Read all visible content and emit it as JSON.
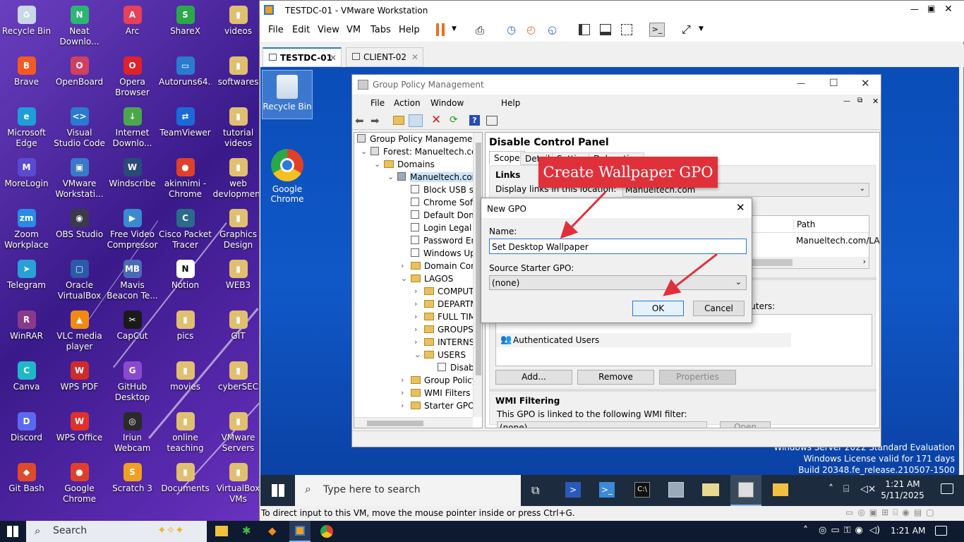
{
  "host_desktop": {
    "icons": [
      {
        "label": "Recycle Bin",
        "glyph": "♻",
        "color": "#c8d8e8"
      },
      {
        "label": "Neat Downlo...",
        "glyph": "N",
        "color": "#2bb673"
      },
      {
        "label": "Arc",
        "glyph": "A",
        "color": "#e8405a"
      },
      {
        "label": "ShareX",
        "glyph": "S",
        "color": "#2aa84a"
      },
      {
        "label": "videos",
        "glyph": "▮",
        "color": "#e0c070"
      },
      {
        "label": "Brave",
        "glyph": "B",
        "color": "#f25a23"
      },
      {
        "label": "OpenBoard",
        "glyph": "O",
        "color": "#d04060"
      },
      {
        "label": "Opera Browser",
        "glyph": "O",
        "color": "#e0202a"
      },
      {
        "label": "Autoruns64....",
        "glyph": "▭",
        "color": "#2a7ad0"
      },
      {
        "label": "softwares",
        "glyph": "▮",
        "color": "#e0c070"
      },
      {
        "label": "Microsoft Edge",
        "glyph": "e",
        "color": "#1e9ed8"
      },
      {
        "label": "Visual Studio Code",
        "glyph": "<>",
        "color": "#2a7ad0"
      },
      {
        "label": "Internet Downlo...",
        "glyph": "↓",
        "color": "#4aa84a"
      },
      {
        "label": "TeamViewer",
        "glyph": "⇄",
        "color": "#1a6ad8"
      },
      {
        "label": "tutorial videos",
        "glyph": "▮",
        "color": "#e0c070"
      },
      {
        "label": "MoreLogin",
        "glyph": "M",
        "color": "#5a4ad0"
      },
      {
        "label": "VMware Workstati...",
        "glyph": "▣",
        "color": "#3a78c8"
      },
      {
        "label": "Windscribe",
        "glyph": "W",
        "color": "#2a4a7a"
      },
      {
        "label": "akinnimi - Chrome",
        "glyph": "●",
        "color": "#e0402a"
      },
      {
        "label": "web devlopment",
        "glyph": "▮",
        "color": "#e0c070"
      },
      {
        "label": "Zoom Workplace",
        "glyph": "zm",
        "color": "#2a8ae8"
      },
      {
        "label": "OBS Studio",
        "glyph": "◉",
        "color": "#3a3a4a"
      },
      {
        "label": "Free Video Compressor",
        "glyph": "▶",
        "color": "#3a8ad0"
      },
      {
        "label": "Cisco Packet Tracer",
        "glyph": "C",
        "color": "#2a6a8a"
      },
      {
        "label": "Graphics Design",
        "glyph": "▮",
        "color": "#e0c070"
      },
      {
        "label": "Telegram",
        "glyph": "➤",
        "color": "#2aa0d8"
      },
      {
        "label": "Oracle VirtualBox",
        "glyph": "▢",
        "color": "#2a5aa8"
      },
      {
        "label": "Mavis Beacon Te...",
        "glyph": "MB",
        "color": "#4a6ab8"
      },
      {
        "label": "Notion",
        "glyph": "N",
        "color": "#ffffff"
      },
      {
        "label": "WEB3",
        "glyph": "▮",
        "color": "#e0c070"
      },
      {
        "label": "WinRAR",
        "glyph": "R",
        "color": "#8a3a8a"
      },
      {
        "label": "VLC media player",
        "glyph": "▲",
        "color": "#f08a10"
      },
      {
        "label": "CapCut",
        "glyph": "✂",
        "color": "#1a1a1a"
      },
      {
        "label": "pics",
        "glyph": "▮",
        "color": "#e0c070"
      },
      {
        "label": "GIT",
        "glyph": "▮",
        "color": "#e0c070"
      },
      {
        "label": "Canva",
        "glyph": "C",
        "color": "#20b8c8"
      },
      {
        "label": "WPS PDF",
        "glyph": "W",
        "color": "#d02a2a"
      },
      {
        "label": "GitHub Desktop",
        "glyph": "G",
        "color": "#8a4ad0"
      },
      {
        "label": "movies",
        "glyph": "▮",
        "color": "#e0c070"
      },
      {
        "label": "cyberSEC",
        "glyph": "▮",
        "color": "#e0c070"
      },
      {
        "label": "Discord",
        "glyph": "D",
        "color": "#5a6af0"
      },
      {
        "label": "WPS Office",
        "glyph": "W",
        "color": "#e0302a"
      },
      {
        "label": "Iriun Webcam",
        "glyph": "◎",
        "color": "#2a2a2a"
      },
      {
        "label": "online teaching",
        "glyph": "▮",
        "color": "#e0c070"
      },
      {
        "label": "VMware Servers",
        "glyph": "▮",
        "color": "#e0c070"
      },
      {
        "label": "Git Bash",
        "glyph": "◆",
        "color": "#e04a2a"
      },
      {
        "label": "Google Chrome",
        "glyph": "●",
        "color": "#e0402a"
      },
      {
        "label": "Scratch 3",
        "glyph": "S",
        "color": "#f0a020"
      },
      {
        "label": "Documents",
        "glyph": "▮",
        "color": "#e0c070"
      },
      {
        "label": "VirtualBox VMs",
        "glyph": "▮",
        "color": "#e0c070"
      }
    ]
  },
  "vmware": {
    "title": "TESTDC-01 - VMware Workstation",
    "menu": [
      "File",
      "Edit",
      "View",
      "VM",
      "Tabs",
      "Help"
    ],
    "tabs": [
      {
        "label": "TESTDC-01"
      },
      {
        "label": "CLIENT-02"
      }
    ],
    "status": "To direct input to this VM, move the mouse pointer inside or press Ctrl+G."
  },
  "guest": {
    "desktop_icons": [
      {
        "label": "Recycle Bin"
      },
      {
        "label": "Google Chrome"
      }
    ],
    "watermark": [
      "Windows Server 2022 Standard Evaluation",
      "Windows License valid for 171 days",
      "Build 20348.fe_release.210507-1500"
    ],
    "search_placeholder": "Type here to search",
    "time": "1:21 AM",
    "date": "5/11/2025"
  },
  "gpm": {
    "title": "Group Policy Management",
    "menu": [
      "File",
      "Action",
      "Window",
      "Help"
    ],
    "tree": [
      {
        "label": "Group Policy Management",
        "indent": 0,
        "kind": "root"
      },
      {
        "label": "Forest: Manueltech.com",
        "indent": 1,
        "kind": "forest"
      },
      {
        "label": "Domains",
        "indent": 2,
        "kind": "folder"
      },
      {
        "label": "Manueltech.com",
        "indent": 3,
        "kind": "domain"
      },
      {
        "label": "Block USB st",
        "indent": 4,
        "kind": "gpo"
      },
      {
        "label": "Chrome Soft",
        "indent": 4,
        "kind": "gpo"
      },
      {
        "label": "Default Dom",
        "indent": 4,
        "kind": "gpo"
      },
      {
        "label": "Login Legal I",
        "indent": 4,
        "kind": "gpo"
      },
      {
        "label": "Password En",
        "indent": 4,
        "kind": "gpo"
      },
      {
        "label": "Windows Up",
        "indent": 4,
        "kind": "gpo"
      },
      {
        "label": "Domain Con",
        "indent": 4,
        "kind": "folder"
      },
      {
        "label": "LAGOS",
        "indent": 4,
        "kind": "folder"
      },
      {
        "label": "COMPUT",
        "indent": 5,
        "kind": "folder"
      },
      {
        "label": "DEPARTM",
        "indent": 5,
        "kind": "folder"
      },
      {
        "label": "FULL TIM",
        "indent": 5,
        "kind": "folder"
      },
      {
        "label": "GROUPS",
        "indent": 5,
        "kind": "folder"
      },
      {
        "label": "INTERNS",
        "indent": 5,
        "kind": "folder"
      },
      {
        "label": "USERS",
        "indent": 5,
        "kind": "folder"
      },
      {
        "label": "Disab",
        "indent": 6,
        "kind": "gpo"
      },
      {
        "label": "Group Policy",
        "indent": 4,
        "kind": "folder"
      },
      {
        "label": "WMI Filters",
        "indent": 4,
        "kind": "folder"
      },
      {
        "label": "Starter GPOs",
        "indent": 4,
        "kind": "folder"
      }
    ],
    "panel_title": "Disable Control Panel",
    "panel_tabs": [
      "Scope",
      "Details",
      "Settings",
      "Delegation"
    ],
    "links_heading": "Links",
    "display_links_label": "Display links in this location:",
    "display_links_value": "Manueltech.com",
    "col_enabled": "abled",
    "col_path": "Path",
    "row_path": "Manueltech.com/LAGO",
    "sec_text": "mputers:",
    "auth_users": "Authenticated Users",
    "btn_add": "Add...",
    "btn_remove": "Remove",
    "btn_properties": "Properties",
    "wmi_heading": "WMI Filtering",
    "wmi_text": "This GPO is linked to the following WMI filter:",
    "wmi_value": "(none)",
    "wmi_open": "Open"
  },
  "dialog": {
    "title": "New GPO",
    "name_label": "Name:",
    "name_value": "Set Desktop Wallpaper",
    "source_label": "Source Starter GPO:",
    "source_value": "(none)",
    "ok": "OK",
    "cancel": "Cancel"
  },
  "annotation": {
    "text": "Create Wallpaper GPO",
    "color": "#e0303a"
  },
  "host_taskbar": {
    "search": "Search",
    "time": "1:21 AM"
  }
}
